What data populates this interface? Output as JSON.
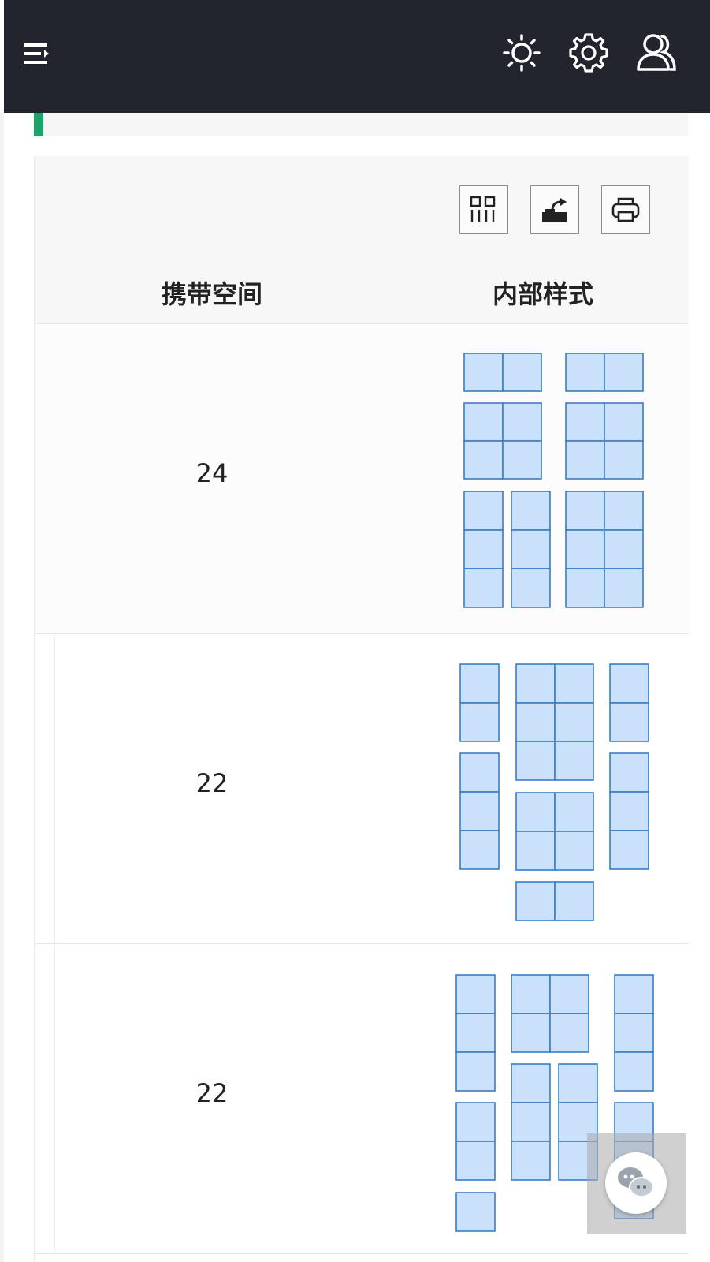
{
  "header": {
    "menu_icon": "menu-collapse-icon",
    "icons": [
      "sun-icon",
      "gear-icon",
      "users-icon"
    ]
  },
  "toolbar": {
    "buttons": [
      "columns-icon",
      "export-icon",
      "printer-icon"
    ]
  },
  "table": {
    "columns": [
      "携带空间",
      "内部样式"
    ],
    "rows": [
      {
        "capacity": "24"
      },
      {
        "capacity": "22"
      },
      {
        "capacity": "22"
      }
    ]
  },
  "floating_button": {
    "icon": "chat-bubbles-icon"
  },
  "colors": {
    "topbar": "#22252e",
    "accent_green": "#1aa56b",
    "cell_fill": "#c9e1fb",
    "cell_stroke": "#3a7dc4"
  }
}
